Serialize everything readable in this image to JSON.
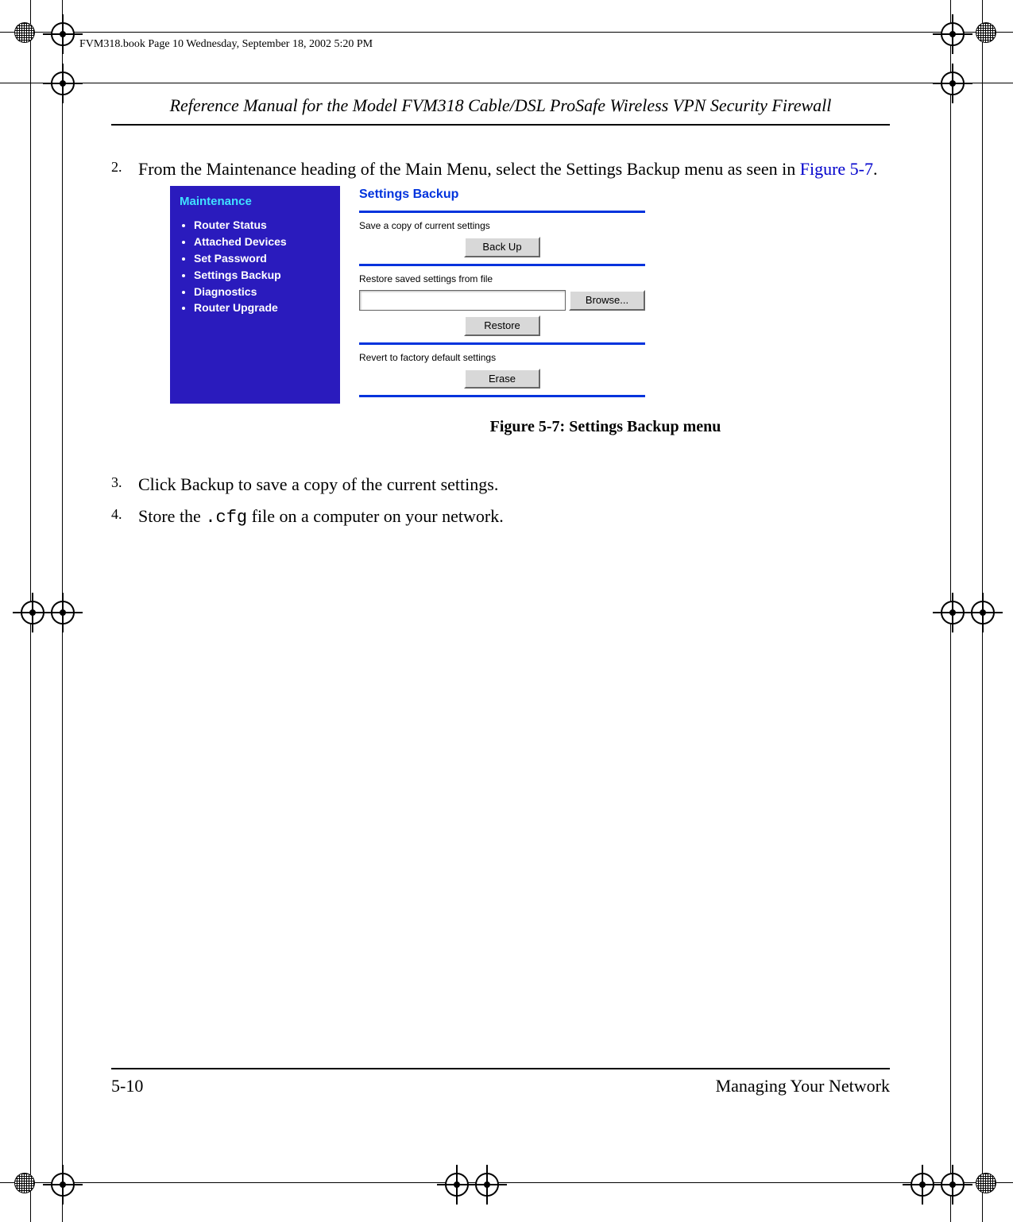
{
  "book_stamp": "FVM318.book  Page 10  Wednesday, September 18, 2002  5:20 PM",
  "running_head": "Reference Manual for the Model FVM318 Cable/DSL ProSafe Wireless VPN Security Firewall",
  "steps": {
    "n2": "2.",
    "t2a": "From the Maintenance heading of the Main Menu, select the Settings Backup menu as seen in ",
    "t2b_link": "Figure 5-7",
    "t2c": ".",
    "n3": "3.",
    "t3": "Click Backup to save a copy of the current settings.",
    "n4": "4.",
    "t4a": "Store the ",
    "t4code": ".cfg",
    "t4b": " file on a computer on your network."
  },
  "figcaption": "Figure 5-7: Settings Backup menu",
  "footer": {
    "left": "5-10",
    "right": "Managing Your Network"
  },
  "shot": {
    "side_header": "Maintenance",
    "side_items": [
      "Router Status",
      "Attached Devices",
      "Set Password",
      "Settings Backup",
      "Diagnostics",
      "Router Upgrade"
    ],
    "panel_title": "Settings Backup",
    "save_label": "Save a copy of current settings",
    "backup_btn": "Back Up",
    "restore_label": "Restore saved settings from file",
    "browse_btn": "Browse...",
    "restore_btn": "Restore",
    "revert_label": "Revert to factory default settings",
    "erase_btn": "Erase"
  }
}
